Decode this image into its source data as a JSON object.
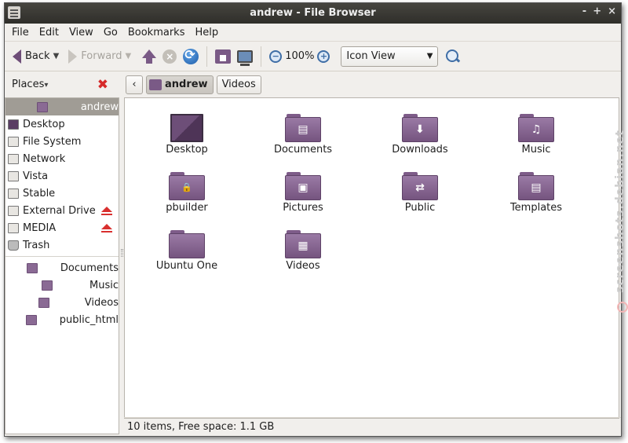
{
  "window": {
    "title": "andrew - File Browser",
    "controls": [
      "-",
      "+",
      "×"
    ]
  },
  "menu": [
    "File",
    "Edit",
    "View",
    "Go",
    "Bookmarks",
    "Help"
  ],
  "toolbar": {
    "back_label": "Back",
    "forward_label": "Forward",
    "zoom_level": "100%",
    "view_mode": "Icon View"
  },
  "sidebar": {
    "header": "Places",
    "items": [
      {
        "label": "andrew",
        "icon": "home-icon",
        "selected": true
      },
      {
        "label": "Desktop",
        "icon": "desktop-icon"
      },
      {
        "label": "File System",
        "icon": "drive-icon"
      },
      {
        "label": "Network",
        "icon": "network-icon"
      },
      {
        "label": "Vista",
        "icon": "drive-icon"
      },
      {
        "label": "Stable",
        "icon": "drive-icon"
      },
      {
        "label": "External Drive",
        "icon": "drive-icon",
        "eject": true
      },
      {
        "label": "MEDIA",
        "icon": "drive-icon",
        "eject": true
      },
      {
        "label": "Trash",
        "icon": "trash-icon"
      }
    ],
    "bookmarks": [
      {
        "label": "Documents",
        "icon": "folder-icon"
      },
      {
        "label": "Music",
        "icon": "folder-icon"
      },
      {
        "label": "Videos",
        "icon": "folder-icon"
      },
      {
        "label": "public_html",
        "icon": "folder-icon"
      }
    ]
  },
  "pathbar": {
    "back": "‹",
    "current": "andrew",
    "next": "Videos"
  },
  "files": [
    {
      "label": "Desktop",
      "icon": "desktop-folder-icon",
      "emblem": ""
    },
    {
      "label": "Documents",
      "icon": "documents-folder-icon",
      "emblem": "▤"
    },
    {
      "label": "Downloads",
      "icon": "downloads-folder-icon",
      "emblem": "⬇"
    },
    {
      "label": "Music",
      "icon": "music-folder-icon",
      "emblem": "♫"
    },
    {
      "label": "pbuilder",
      "icon": "locked-folder-icon",
      "emblem": "🔒"
    },
    {
      "label": "Pictures",
      "icon": "pictures-folder-icon",
      "emblem": "▣"
    },
    {
      "label": "Public",
      "icon": "public-folder-icon",
      "emblem": "⇄"
    },
    {
      "label": "Templates",
      "icon": "templates-folder-icon",
      "emblem": "▤"
    },
    {
      "label": "Ubuntu One",
      "icon": "folder-icon",
      "emblem": ""
    },
    {
      "label": "Videos",
      "icon": "videos-folder-icon",
      "emblem": "▦"
    }
  ],
  "status": "10 items, Free space: 1.1 GB",
  "watermark": "screenshots.debian.net",
  "colors": {
    "accent": "#7a5a86",
    "selection": "#a09c95",
    "titlebar": "#3a3935"
  }
}
